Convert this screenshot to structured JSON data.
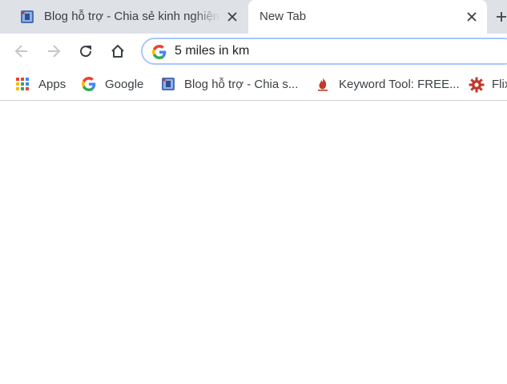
{
  "tabs": [
    {
      "title": "Blog hỗ trợ - Chia sẻ kinh nghiệm",
      "active": false
    },
    {
      "title": "New Tab",
      "active": true
    }
  ],
  "omnibox": {
    "value": "5 miles in km"
  },
  "bookmarks": [
    {
      "label": "Apps",
      "icon": "apps-grid-icon"
    },
    {
      "label": "Google",
      "icon": "google-g-icon"
    },
    {
      "label": "Blog hỗ trợ - Chia s...",
      "icon": "blog-favicon-icon"
    },
    {
      "label": "Keyword Tool: FREE...",
      "icon": "keyword-tool-flame-icon"
    },
    {
      "label": "Flix",
      "icon": "red-gear-icon"
    }
  ],
  "colors": {
    "tabstrip": "#dee1e6",
    "omnibox_border": "#a8c7fa",
    "text": "#3c4043"
  }
}
